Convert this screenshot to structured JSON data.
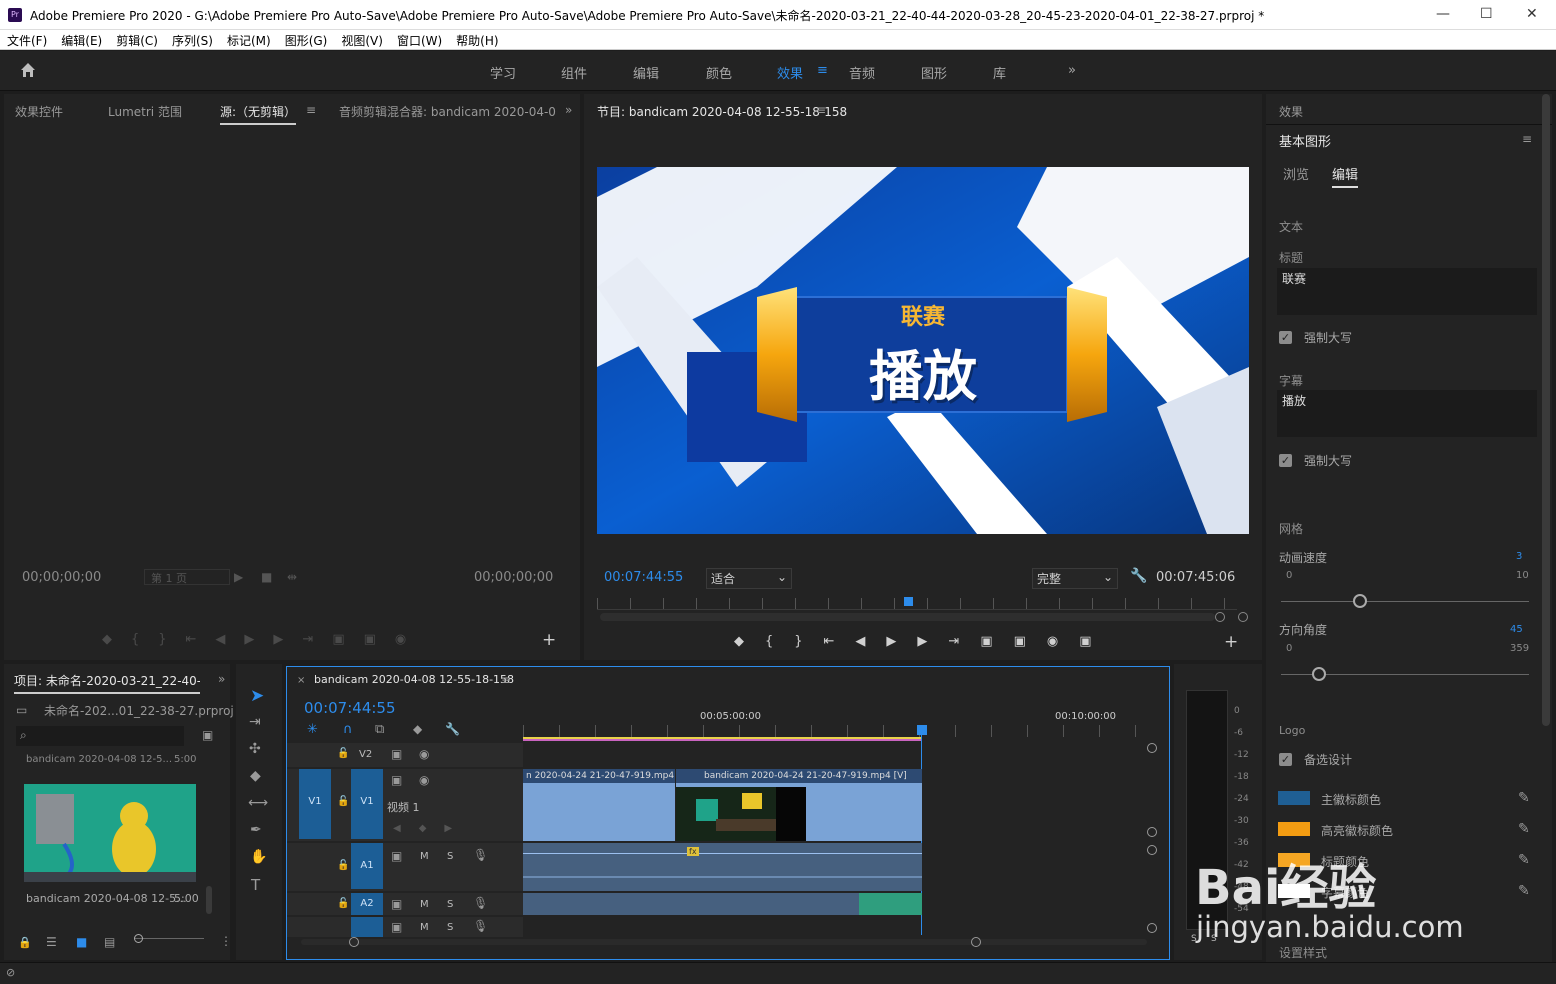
{
  "app": {
    "icon": "Pr",
    "title": "Adobe Premiere Pro 2020 - G:\\Adobe Premiere Pro Auto-Save\\Adobe Premiere Pro Auto-Save\\Adobe Premiere Pro Auto-Save\\未命名-2020-03-21_22-40-44-2020-03-28_20-45-23-2020-04-01_22-38-27.prproj *"
  },
  "menu": [
    "文件(F)",
    "编辑(E)",
    "剪辑(C)",
    "序列(S)",
    "标记(M)",
    "图形(G)",
    "视图(V)",
    "窗口(W)",
    "帮助(H)"
  ],
  "workspaces": [
    "学习",
    "组件",
    "编辑",
    "颜色",
    "效果",
    "音频",
    "图形",
    "库"
  ],
  "source": {
    "tabs": [
      "效果控件",
      "Lumetri 范围",
      "源:（无剪辑）",
      "音频剪辑混合器: bandicam 2020-04-0"
    ],
    "tc_left": "00;00;00;00",
    "page": "第 1 页",
    "tc_right": "00;00;00;00"
  },
  "program": {
    "tab": "节目: bandicam 2020-04-08 12-55-18-158",
    "tc": "00:07:44:55",
    "fit": "适合",
    "quality": "完整",
    "duration": "00:07:45:06",
    "overlay_small": "联赛",
    "overlay_big": "播放"
  },
  "project": {
    "tab": "项目: 未命名-2020-03-21_22-40-4",
    "file": "未命名-202...01_22-38-27.prproj",
    "item_top": "bandicam 2020-04-08 12-5...",
    "item_top_dur": "5:00",
    "item_name": "bandicam 2020-04-08 12-5...",
    "item_dur": "5:00"
  },
  "timeline": {
    "tab": "bandicam 2020-04-08 12-55-18-158",
    "tc": "00:07:44:55",
    "ruler": [
      "00:05:00:00",
      "00:10:00:00"
    ],
    "tracks": {
      "v2": "V2",
      "v1": "V1",
      "v1src": "V1",
      "a1": "A1",
      "a2": "A2",
      "video1": "视频 1",
      "m": "M",
      "s": "S"
    },
    "clip1": "n 2020-04-24 21-20-47-919.mp4 [V]",
    "clip2": "bandicam 2020-04-24 21-20-47-919.mp4 [V]",
    "fx": "fx"
  },
  "meter": {
    "labels": [
      "0",
      "-6",
      "-12",
      "-18",
      "-24",
      "-30",
      "-36",
      "-42",
      "-48",
      "-54"
    ],
    "s": "S",
    "s2": "S"
  },
  "effects": {
    "title": "效果",
    "panel": "基本图形",
    "tab_browse": "浏览",
    "tab_edit": "编辑",
    "sec_text": "文本",
    "lbl_title": "标题",
    "title_value": "联赛",
    "force_caps1": "强制大写",
    "lbl_sub": "字幕",
    "sub_value": "播放",
    "force_caps2": "强制大写",
    "sec_grid": "网格",
    "anim_speed": "动画速度",
    "anim_speed_val": "3",
    "anim_min": "0",
    "anim_max": "10",
    "angle": "方向角度",
    "angle_val": "45",
    "angle_min": "0",
    "angle_max": "359",
    "sec_logo": "Logo",
    "alt_design": "备选设计",
    "color1": "主徽标颜色",
    "color2": "高亮徽标颜色",
    "color3": "标题颜色",
    "color4": "字幕颜色",
    "set_style": "设置样式"
  },
  "colors": {
    "c1": "#1f5f94",
    "c2": "#f39c12",
    "c3": "#f5a623",
    "c4": "#ffffff",
    "accent": "#2d8ceb"
  },
  "watermark": {
    "text": "Bai经验",
    "url": "jingyan.baidu.com"
  }
}
